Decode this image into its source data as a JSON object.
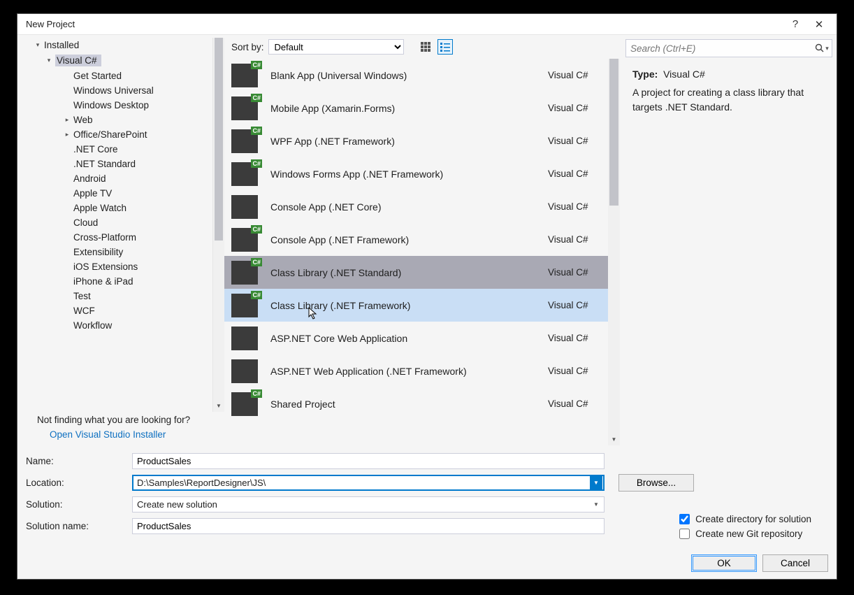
{
  "window": {
    "title": "New Project",
    "help": "?",
    "close": "✕"
  },
  "sidebar": {
    "nodes": [
      {
        "label": "Installed",
        "depth": 0,
        "glyph": "▾"
      },
      {
        "label": "Visual C#",
        "depth": 1,
        "glyph": "▾",
        "selected": true
      },
      {
        "label": "Get Started",
        "depth": 2
      },
      {
        "label": "Windows Universal",
        "depth": 2
      },
      {
        "label": "Windows Desktop",
        "depth": 2
      },
      {
        "label": "Web",
        "depth": 2,
        "glyph": "▸"
      },
      {
        "label": "Office/SharePoint",
        "depth": 2,
        "glyph": "▸"
      },
      {
        "label": ".NET Core",
        "depth": 2
      },
      {
        "label": ".NET Standard",
        "depth": 2
      },
      {
        "label": "Android",
        "depth": 2
      },
      {
        "label": "Apple TV",
        "depth": 2
      },
      {
        "label": "Apple Watch",
        "depth": 2
      },
      {
        "label": "Cloud",
        "depth": 2
      },
      {
        "label": "Cross-Platform",
        "depth": 2
      },
      {
        "label": "Extensibility",
        "depth": 2
      },
      {
        "label": "iOS Extensions",
        "depth": 2
      },
      {
        "label": "iPhone & iPad",
        "depth": 2
      },
      {
        "label": "Test",
        "depth": 2
      },
      {
        "label": "WCF",
        "depth": 2
      },
      {
        "label": "Workflow",
        "depth": 2
      }
    ],
    "not_finding": "Not finding what you are looking for?",
    "installer_link": "Open Visual Studio Installer"
  },
  "toolbar": {
    "sort_label": "Sort by:",
    "sort_value": "Default"
  },
  "templates": [
    {
      "name": "Blank App (Universal Windows)",
      "lang": "Visual C#"
    },
    {
      "name": "Mobile App (Xamarin.Forms)",
      "lang": "Visual C#"
    },
    {
      "name": "WPF App (.NET Framework)",
      "lang": "Visual C#"
    },
    {
      "name": "Windows Forms App (.NET Framework)",
      "lang": "Visual C#"
    },
    {
      "name": "Console App (.NET Core)",
      "lang": "Visual C#",
      "noicon": true
    },
    {
      "name": "Console App (.NET Framework)",
      "lang": "Visual C#"
    },
    {
      "name": "Class Library (.NET Standard)",
      "lang": "Visual C#",
      "selected": true
    },
    {
      "name": "Class Library (.NET Framework)",
      "lang": "Visual C#",
      "hover": true
    },
    {
      "name": "ASP.NET Core Web Application",
      "lang": "Visual C#",
      "noicon": true
    },
    {
      "name": "ASP.NET Web Application (.NET Framework)",
      "lang": "Visual C#",
      "noicon": true
    },
    {
      "name": "Shared Project",
      "lang": "Visual C#"
    }
  ],
  "search": {
    "placeholder": "Search (Ctrl+E)"
  },
  "description": {
    "type_label": "Type:",
    "type_value": "Visual C#",
    "text": "A project for creating a class library that targets .NET Standard."
  },
  "form": {
    "name_label": "Name:",
    "name_value": "ProductSales",
    "location_label": "Location:",
    "location_value": "D:\\Samples\\ReportDesigner\\JS\\",
    "browse": "Browse...",
    "solution_label": "Solution:",
    "solution_value": "Create new solution",
    "solution_name_label": "Solution name:",
    "solution_name_value": "ProductSales",
    "check_dir": "Create directory for solution",
    "check_dir_checked": true,
    "check_git": "Create new Git repository",
    "check_git_checked": false
  },
  "buttons": {
    "ok": "OK",
    "cancel": "Cancel"
  }
}
